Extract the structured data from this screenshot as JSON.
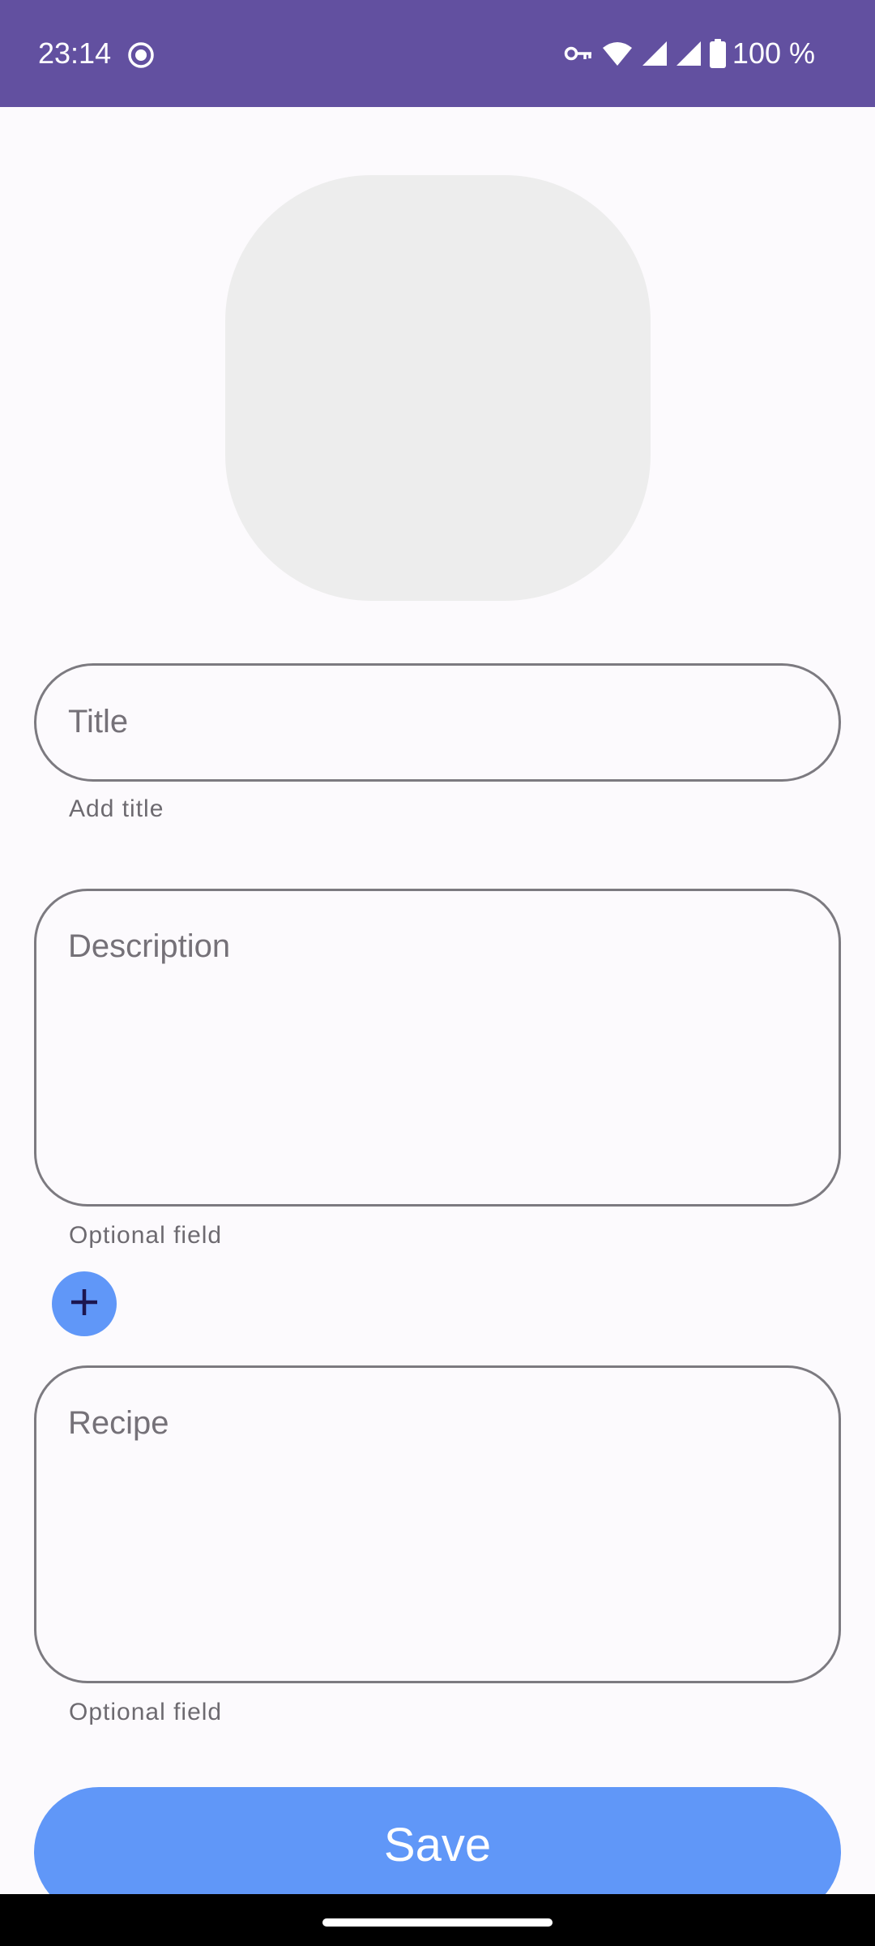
{
  "status_bar": {
    "time": "23:14",
    "battery_text": "100 %",
    "background_color": "#6250A0",
    "icons": [
      "screen-record-icon",
      "vpn-key-icon",
      "wifi-icon",
      "signal-icon",
      "signal-icon",
      "battery-icon"
    ]
  },
  "form": {
    "image_placeholder_color": "#EDEDED",
    "title": {
      "value": "",
      "placeholder": "Title",
      "helper": "Add title"
    },
    "description": {
      "value": "",
      "placeholder": "Description",
      "helper": "Optional field"
    },
    "add_button_icon": "plus-icon",
    "recipe": {
      "value": "",
      "placeholder": "Recipe",
      "helper": "Optional field"
    },
    "save_label": "Save",
    "accent_color": "#6097F8"
  }
}
